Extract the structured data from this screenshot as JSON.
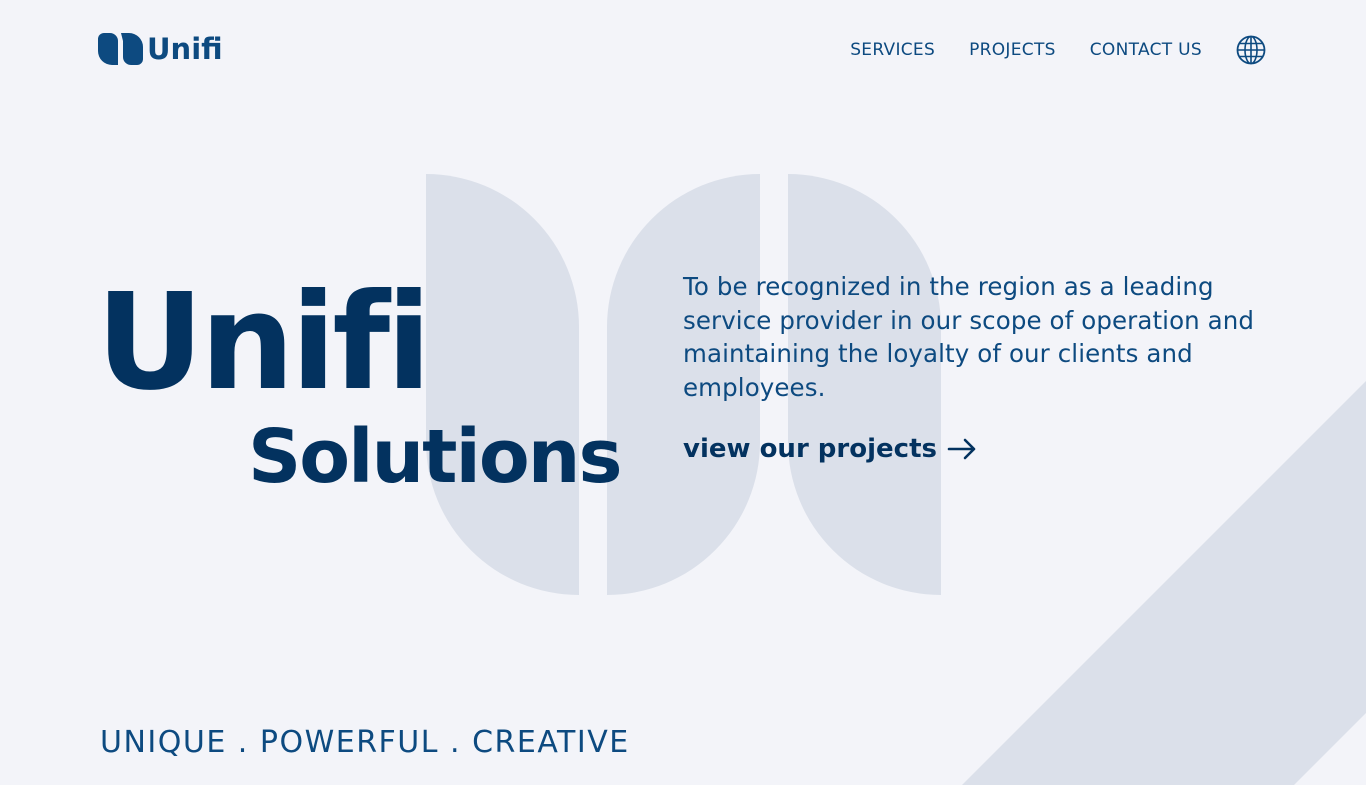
{
  "brand": {
    "name": "Unifi",
    "primary_color": "#03325f",
    "accent_color": "#0d4a80",
    "shape_color": "#dbe0ea",
    "background_color": "#f3f4f9"
  },
  "header": {
    "logo_icon": "unifi-logo-mark-icon",
    "logo_text": "Unifi",
    "nav": [
      {
        "label": "SERVICES"
      },
      {
        "label": "PROJECTS"
      },
      {
        "label": "CONTACT US"
      }
    ],
    "language_icon": "globe-icon"
  },
  "hero": {
    "title_line1": "Unifi",
    "title_line2": "Solutions",
    "mission": "To be recognized in the region as a leading service provider in our scope of operation and maintaining the loyalty of our clients and employees.",
    "cta_label": "view our projects",
    "cta_icon": "arrow-right-icon"
  },
  "tagline": "UNIQUE . POWERFUL  . CREATIVE"
}
